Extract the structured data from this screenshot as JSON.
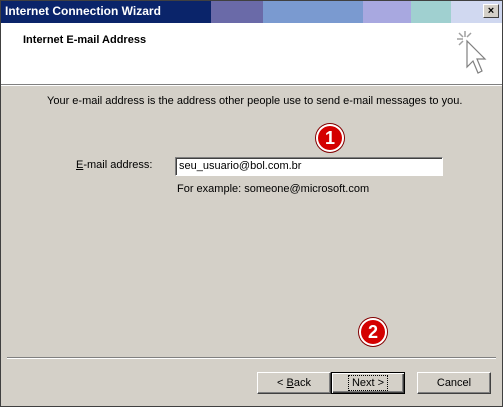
{
  "window": {
    "title": "Internet Connection Wizard",
    "close_glyph": "×",
    "titlebar_colors": [
      "#0a246a",
      "#3a4a86",
      "#6a6aa8",
      "#7a9ad0",
      "#8ab0e0",
      "#a8a8e0",
      "#a0d0d0",
      "#d0d8f0"
    ]
  },
  "header": {
    "title": "Internet E-mail Address",
    "icon": "wizard-cursor-icon"
  },
  "body": {
    "description": "Your e-mail address is the address other people use to send e-mail messages to you.",
    "email_label_prefix": "E",
    "email_label_rest": "-mail address:",
    "email_value": "seu_usuario@bol.com.br",
    "example": "For example: someone@microsoft.com"
  },
  "annotations": {
    "badge1": "1",
    "badge2": "2",
    "badge_color": "#d40000"
  },
  "buttons": {
    "back_prefix": "< ",
    "back_accel": "B",
    "back_rest": "ack",
    "next": "Next >",
    "cancel": "Cancel"
  }
}
